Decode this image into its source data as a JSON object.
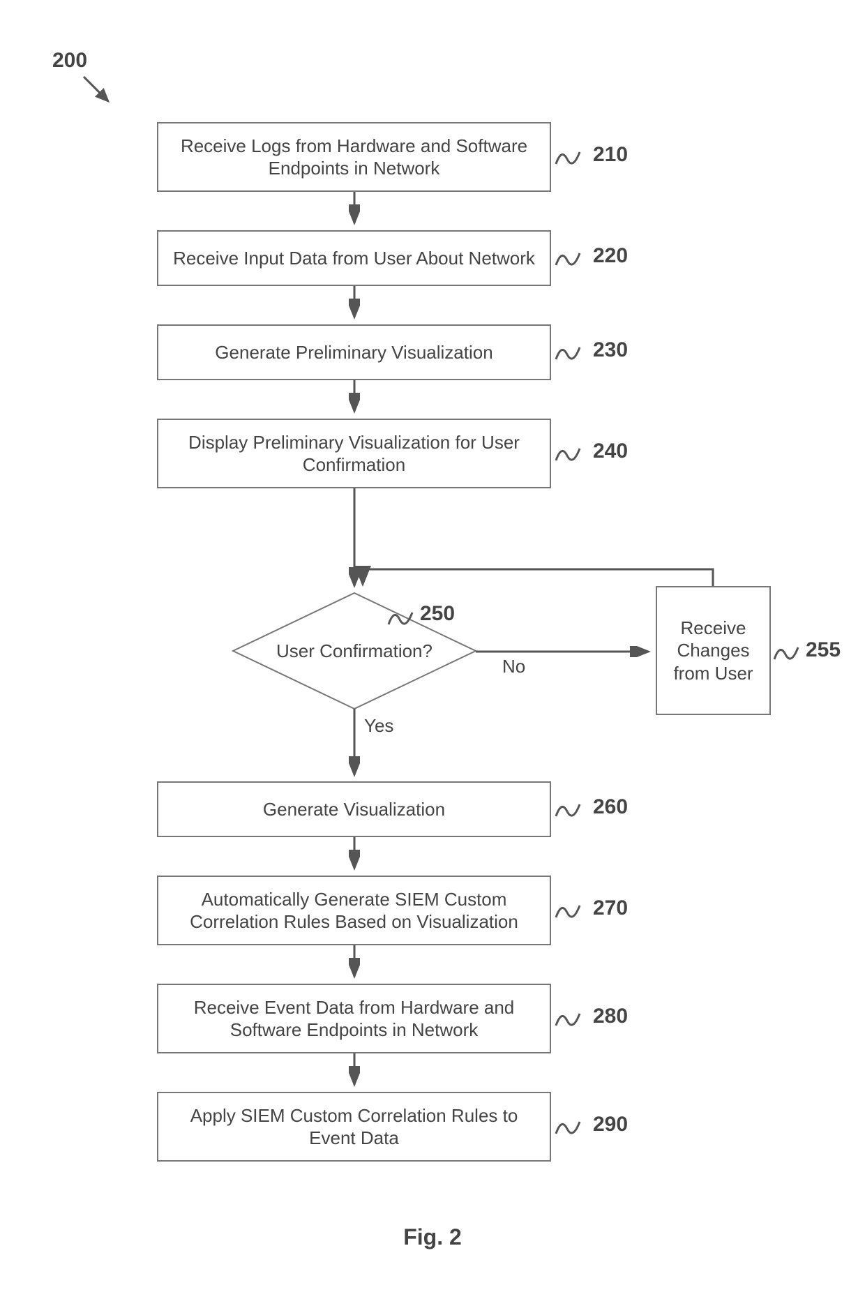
{
  "figure_ref": "200",
  "figure_caption": "Fig. 2",
  "decision": {
    "text": "User Confirmation?",
    "ref": "250",
    "yes_label": "Yes",
    "no_label": "No"
  },
  "side_box": {
    "text": "Receive Changes from User",
    "ref": "255"
  },
  "steps": [
    {
      "id": "s210",
      "text": "Receive Logs from Hardware and Software Endpoints in Network",
      "ref": "210"
    },
    {
      "id": "s220",
      "text": "Receive Input Data from User About Network",
      "ref": "220"
    },
    {
      "id": "s230",
      "text": "Generate Preliminary Visualization",
      "ref": "230"
    },
    {
      "id": "s240",
      "text": "Display Preliminary Visualization for User Confirmation",
      "ref": "240"
    },
    {
      "id": "s260",
      "text": "Generate Visualization",
      "ref": "260"
    },
    {
      "id": "s270",
      "text": "Automatically Generate SIEM Custom Correlation Rules Based on Visualization",
      "ref": "270"
    },
    {
      "id": "s280",
      "text": "Receive Event Data from Hardware and Software Endpoints in Network",
      "ref": "280"
    },
    {
      "id": "s290",
      "text": "Apply SIEM Custom Correlation Rules to Event Data",
      "ref": "290"
    }
  ]
}
